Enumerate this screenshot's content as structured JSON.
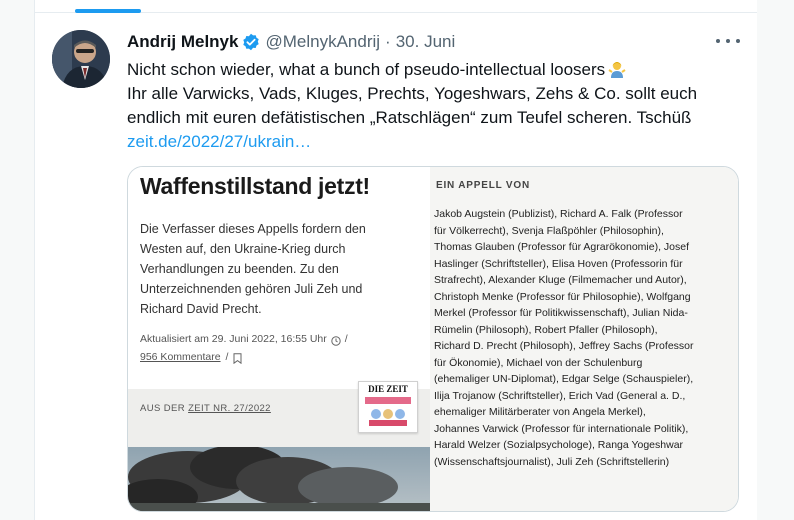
{
  "tweet": {
    "author_name": "Andrij Melnyk",
    "handle": "@MelnykAndrij",
    "separator": "·",
    "date": "30. Juni",
    "text_lines": [
      "Nicht schon wieder, what a bunch of pseudo-intellectual loosers",
      "Ihr alle Varwicks, Vads, Kluges, Prechts, Yogeshwars, Zehs & Co. sollt euch",
      "endlich mit euren defätistischen „Ratschlägen“ zum Teufel scheren. Tschüß"
    ],
    "link": "zeit.de/2022/27/ukrain…",
    "emoji": "person-shrugging"
  },
  "card": {
    "headline": "Waffenstillstand jetzt!",
    "intro_lines": [
      "Die Verfasser dieses Appells fordern den",
      "Westen auf, den Ukraine-Krieg durch",
      "Verhandlungen zu beenden. Zu den",
      "Unterzeichnenden gehören Juli Zeh und",
      "Richard David Precht."
    ],
    "updated": "Aktualisiert am 29. Juni 2022, 16:55 Uhr",
    "slash": "/",
    "comments": "956 Kommentare",
    "source_prefix": "AUS DER",
    "source_link": "ZEIT NR. 27/2022",
    "thumb_label": "DIE ZEIT",
    "appeal_title": "EIN APPELL VON",
    "signatories_lines": [
      "Jakob Augstein (Publizist), Richard A. Falk (Professor",
      "für Völkerrecht), Svenja Flaßpöhler (Philosophin),",
      "Thomas Glauben (Professor für Agrarökonomie), Josef",
      "Haslinger (Schriftsteller), Elisa Hoven (Professorin für",
      "Strafrecht), Alexander Kluge (Filmemacher und Autor),",
      "Christoph Menke (Professor für Philosophie), Wolfgang",
      "Merkel (Professor für Politikwissenschaft), Julian Nida-",
      "Rümelin (Philosoph), Robert Pfaller (Philosoph),",
      "Richard D. Precht (Philosoph), Jeffrey Sachs (Professor",
      "für Ökonomie), Michael von der Schulenburg",
      "(ehemaliger UN-Diplomat), Edgar Selge (Schauspieler),",
      "Ilija Trojanow (Schriftsteller), Erich Vad (General a. D.,",
      "ehemaliger Militärberater von Angela Merkel),",
      "Johannes Varwick (Professor für internationale Politik),",
      "Harald Welzer (Sozialpsychologe), Ranga Yogeshwar",
      "(Wissenschaftsjournalist), Juli Zeh (Schriftstellerin)"
    ]
  },
  "colors": {
    "accent": "#1d9bf0",
    "text": "#0f1419",
    "muted": "#536471"
  }
}
